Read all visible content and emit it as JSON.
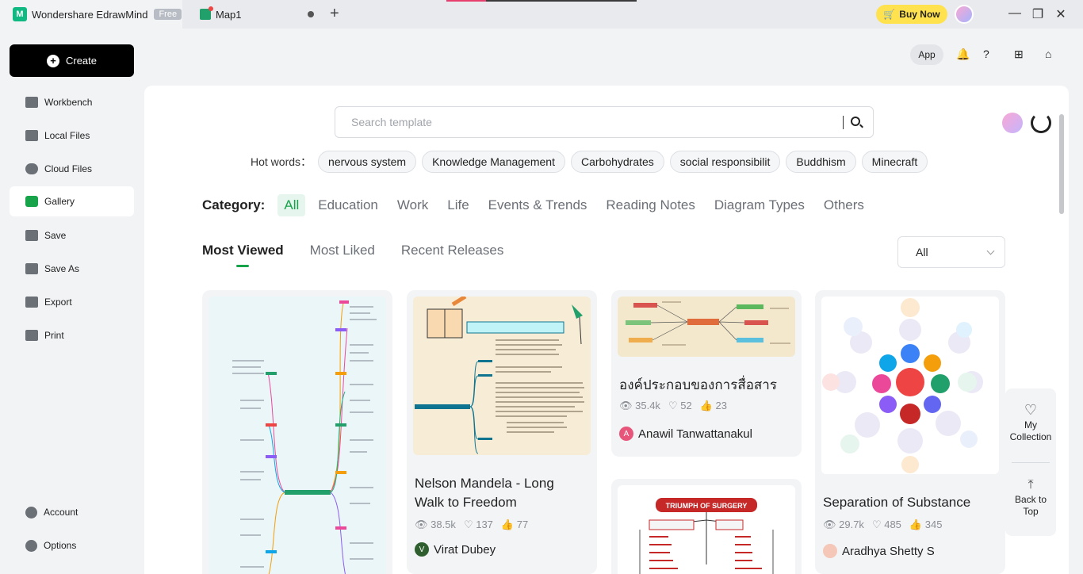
{
  "titlebar": {
    "app_tab": "Wondershare EdrawMind",
    "free_badge": "Free",
    "map_tab": "Map1",
    "new_tab": "+",
    "buy_now": "Buy Now",
    "window": {
      "minimize": "—",
      "maximize": "❐",
      "close": "✕"
    }
  },
  "sidebar": {
    "create": "Create",
    "items": [
      {
        "label": "Workbench",
        "icon": "workbench-icon"
      },
      {
        "label": "Local Files",
        "icon": "folder-icon"
      },
      {
        "label": "Cloud Files",
        "icon": "cloud-icon"
      },
      {
        "label": "Gallery",
        "icon": "gallery-icon"
      },
      {
        "label": "Save",
        "icon": "save-icon"
      },
      {
        "label": "Save As",
        "icon": "save-as-icon"
      },
      {
        "label": "Export",
        "icon": "export-icon"
      },
      {
        "label": "Print",
        "icon": "print-icon"
      }
    ],
    "bottom": [
      {
        "label": "Account",
        "icon": "account-icon"
      },
      {
        "label": "Options",
        "icon": "gear-icon"
      }
    ]
  },
  "toolbar": {
    "app": "App",
    "bell": "🔔",
    "help": "?",
    "apps": "⊞",
    "shirt": "⌂"
  },
  "search": {
    "placeholder": "Search template"
  },
  "hotwords": {
    "label": "Hot words：",
    "items": [
      "nervous system",
      "Knowledge Management",
      "Carbohydrates",
      "social responsibilit",
      "Buddhism",
      "Minecraft"
    ]
  },
  "category": {
    "label": "Category:",
    "items": [
      "All",
      "Education",
      "Work",
      "Life",
      "Events & Trends",
      "Reading Notes",
      "Diagram Types",
      "Others"
    ]
  },
  "sort": {
    "tabs": [
      "Most Viewed",
      "Most Liked",
      "Recent Releases"
    ],
    "filter": "All"
  },
  "cards": [
    {
      "title": "Nelson Mandela - Long Walk to Freedom",
      "title_l1": "Nelson Mandela - Long",
      "title_l2": "Walk to Freedom",
      "views": "38.5k",
      "likes": "137",
      "thumbs": "77",
      "author": "Virat Dubey",
      "author_initial": "V"
    },
    {
      "title": "องค์ประกอบของการสื่อสาร",
      "views": "35.4k",
      "likes": "52",
      "thumbs": "23",
      "author": "Anawil Tanwattanakul",
      "author_initial": "A"
    },
    {
      "title": "Separation of Substance",
      "views": "29.7k",
      "likes": "485",
      "thumbs": "345",
      "author": "Aradhya Shetty S",
      "author_initial": ""
    },
    {
      "thumb_text": "TRIUMPH OF SURGERY"
    }
  ],
  "float": {
    "collection": "My Collection",
    "collection_l1": "My",
    "collection_l2": "Collection",
    "back_top_l1": "Back to",
    "back_top_l2": "Top"
  },
  "colors": {
    "brand": "#17a34a",
    "buy": "#ffe24d"
  }
}
